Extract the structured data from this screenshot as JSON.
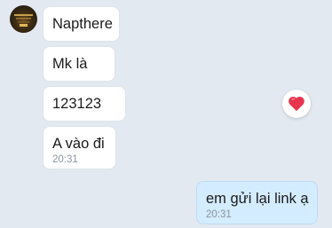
{
  "chat": {
    "messages": [
      {
        "text": "Napthere",
        "time": ""
      },
      {
        "text": "Mk là",
        "time": ""
      },
      {
        "text": "123123",
        "time": ""
      },
      {
        "text": "A vào đi",
        "time": "20:31"
      },
      {
        "text": "em gửi lại link ạ",
        "time": "20:31"
      }
    ],
    "reaction_icon": "heart-icon",
    "colors": {
      "background": "#e3e9f1",
      "incoming_bubble": "#ffffff",
      "outgoing_bubble": "#d4ecff",
      "heart": "#e8344e"
    }
  }
}
